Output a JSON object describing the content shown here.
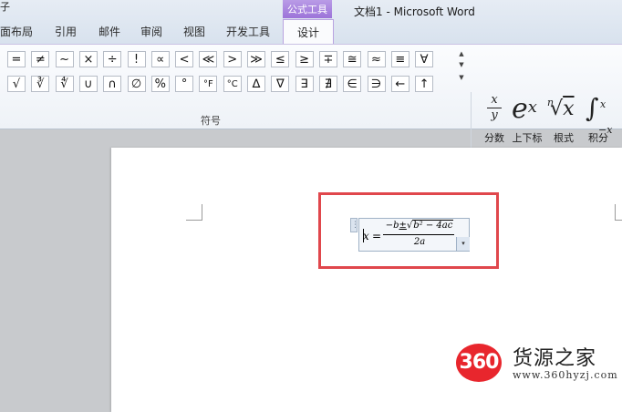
{
  "window": {
    "title": "文档1 - Microsoft Word",
    "partial_tab": "子"
  },
  "tabs": [
    {
      "label": "页面布局",
      "visible_text": "面布局"
    },
    {
      "label": "引用"
    },
    {
      "label": "邮件"
    },
    {
      "label": "审阅"
    },
    {
      "label": "视图"
    },
    {
      "label": "开发工具"
    }
  ],
  "contextual": {
    "header": "公式工具",
    "active_tab": "设计"
  },
  "ribbon": {
    "symbols_group_label": "符号",
    "symbols_row1": [
      "=",
      "≠",
      "~",
      "×",
      "÷",
      "!",
      "∝",
      "<",
      "≪",
      ">",
      "≫",
      "≤",
      "≥",
      "∓",
      "≅",
      "≈",
      "≡",
      "∀"
    ],
    "symbols_row2": [
      "√",
      "∛",
      "∜",
      "∪",
      "∩",
      "∅",
      "%",
      "°",
      "°F",
      "°C",
      "∆",
      "∇",
      "∃",
      "∄",
      "∈",
      "∋",
      "←",
      "↑"
    ],
    "scroll_up": "▲",
    "scroll_more": "▼",
    "structures": [
      {
        "label": "分数",
        "icon": "fraction-icon"
      },
      {
        "label": "上下标",
        "icon": "script-icon"
      },
      {
        "label": "根式",
        "icon": "radical-icon"
      },
      {
        "label": "积分",
        "icon": "integral-icon"
      }
    ],
    "structure_glyphs": {
      "fraction_num": "x",
      "fraction_den": "y",
      "script_base": "e",
      "script_sup": "x",
      "radical_index": "n",
      "radical_sign": "√",
      "radical_body": "x",
      "integral_sign": "∫",
      "integral_upper": "x",
      "integral_lower": "−x"
    },
    "dropdown_arrow": "▾",
    "cut_off_text": "­"
  },
  "document": {
    "equation": {
      "variable": "x",
      "equals": "=",
      "numerator_neg_b": "−b",
      "numerator_pm": "±",
      "numerator_radical": "√",
      "numerator_radicand": "b² − 4ac",
      "denominator": "2a",
      "handle_glyph": "⋮",
      "dropdown_glyph": "▾"
    }
  },
  "watermark": {
    "badge": "360",
    "name": "货源之家",
    "url": "www.360hyzj.com"
  },
  "colors": {
    "accent_purple": "#9c73d9",
    "highlight_red": "#e0474c",
    "badge_red": "#e8262d"
  }
}
